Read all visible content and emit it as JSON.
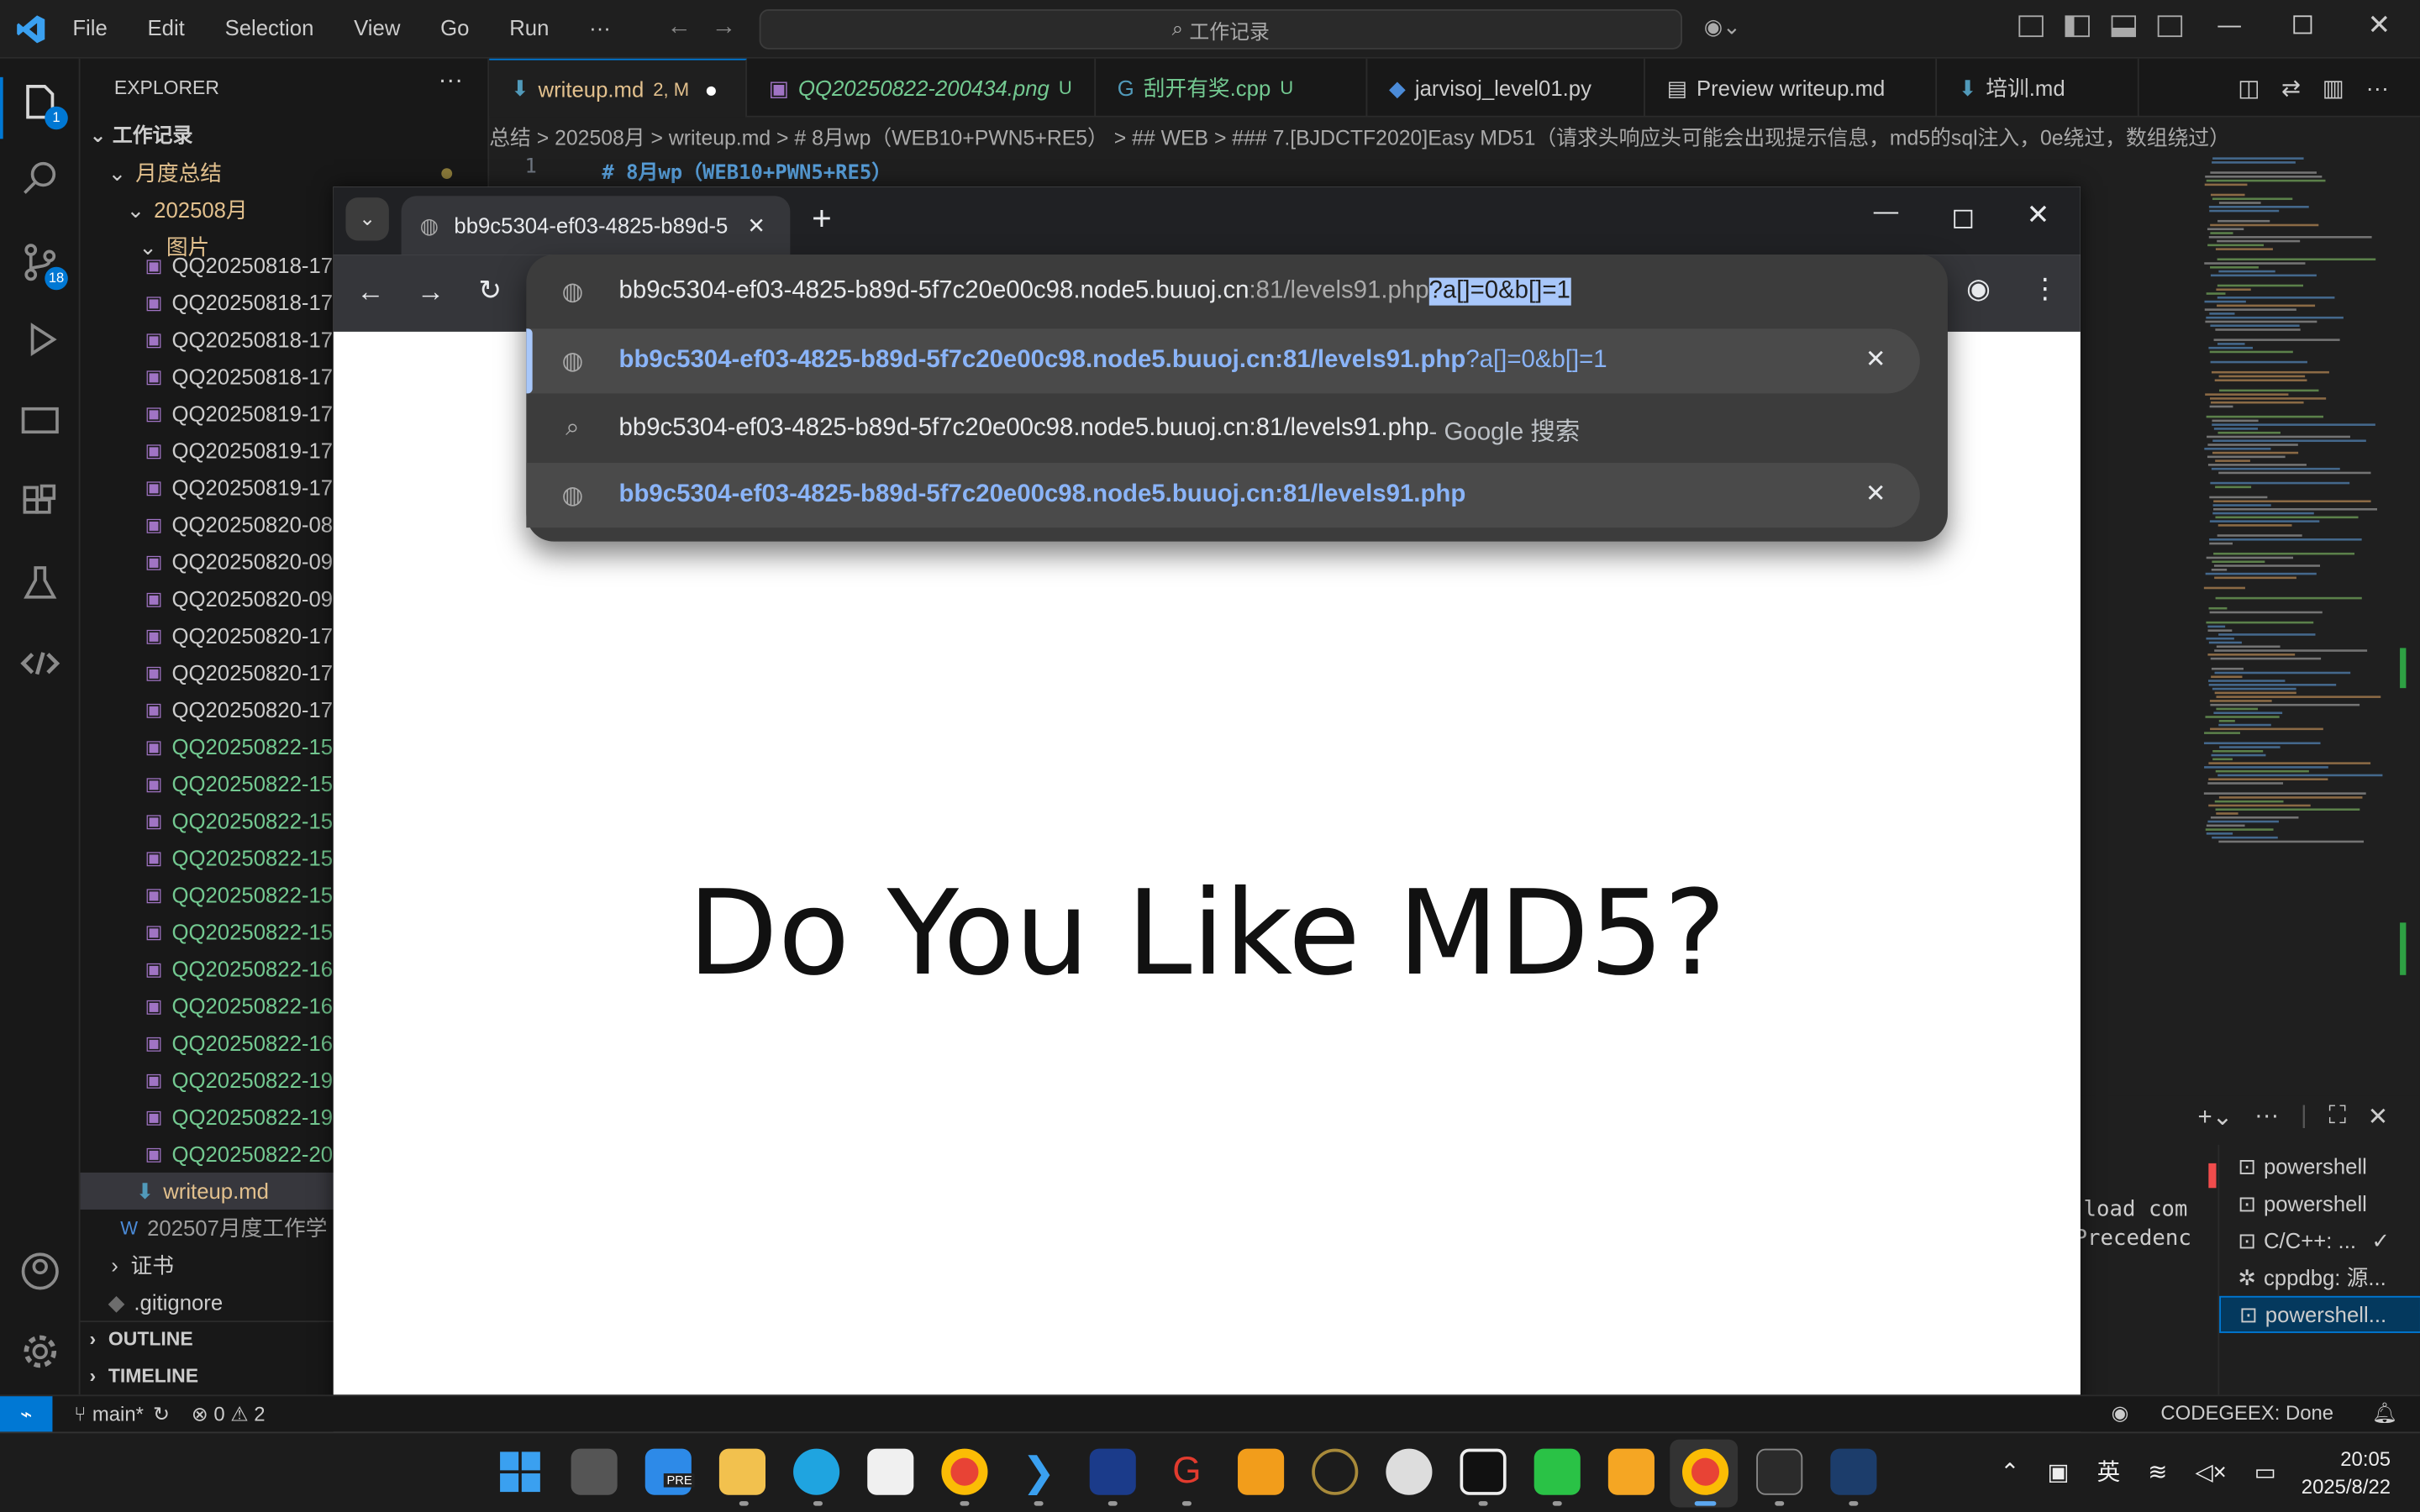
{
  "titlebar": {
    "menus": [
      "File",
      "Edit",
      "Selection",
      "View",
      "Go",
      "Run",
      "···"
    ],
    "search": "工作记录"
  },
  "activity": {
    "explorer_badge": "1",
    "scm_badge": "18"
  },
  "sidebar": {
    "title": "EXPLORER",
    "root": "工作记录",
    "folder1": "月度总结",
    "folder2": "202508月",
    "folder3": "图片",
    "files": [
      "QQ20250818-17",
      "QQ20250818-17",
      "QQ20250818-17",
      "QQ20250818-17",
      "QQ20250819-17",
      "QQ20250819-17",
      "QQ20250819-17",
      "QQ20250820-08",
      "QQ20250820-09",
      "QQ20250820-09",
      "QQ20250820-17",
      "QQ20250820-17",
      "QQ20250820-17",
      "QQ20250822-15",
      "QQ20250822-15",
      "QQ20250822-15",
      "QQ20250822-15",
      "QQ20250822-15",
      "QQ20250822-15",
      "QQ20250822-16",
      "QQ20250822-16",
      "QQ20250822-16",
      "QQ20250822-19",
      "QQ20250822-19",
      "QQ20250822-20"
    ],
    "writeup": "writeup.md",
    "docx": "202507月度工作学",
    "cert": "证书",
    "gitignore": ".gitignore",
    "outline": "OUTLINE",
    "timeline": "TIMELINE"
  },
  "tabs": [
    {
      "label": "writeup.md",
      "suffix": "2, M"
    },
    {
      "label": "QQ20250822-200434.png",
      "suffix": "U"
    },
    {
      "label": "刮开有奖.cpp",
      "suffix": "U"
    },
    {
      "label": "jarvisoj_level01.py",
      "suffix": ""
    },
    {
      "label": "Preview writeup.md",
      "suffix": ""
    },
    {
      "label": "培训.md",
      "suffix": ""
    }
  ],
  "breadcrumb": "总结 > 202508月 > writeup.md > # 8月wp（WEB10+PWN5+RE5） > ## WEB > ### 7.[BJDCTF2020]Easy MD51（请求头响应头可能会出现提示信息，md5的sql注入，0e绕过，数组绕过）",
  "editor": {
    "line_no": "1",
    "line_text": "# 8月wp（WEB10+PWN5+RE5）"
  },
  "chrome": {
    "tab_title": "bb9c5304-ef03-4825-b89d-5",
    "url_base": "bb9c5304-ef03-4825-b89d-5f7c20e00c98.node5.buuoj.cn",
    "url_port_path": ":81/levels91.php",
    "url_query": "?a[]=0&b[]=1",
    "suggestions": [
      {
        "bold": "bb9c5304-ef03-4825-b89d-5f7c20e00c98.node5.buuoj.cn:81/levels91.php",
        "rest": "?a[]=0&b[]=1"
      },
      {
        "text": "bb9c5304-ef03-4825-b89d-5f7c20e00c98.node5.buuoj.cn:81/levels91.php",
        "rest": " - Google 搜索"
      },
      {
        "bold": "bb9c5304-ef03-4825-b89d-5f7c20e00c98.node5.buuoj.cn:81/levels91.php",
        "rest": ""
      }
    ],
    "page_heading": "Do You Like MD5?"
  },
  "terminal": {
    "text1": "load com",
    "text2": "Precedenc",
    "items": [
      "powershell",
      "powershell",
      "C/C++: ...",
      "cppdbg: 源...",
      "powershell..."
    ]
  },
  "statusbar": {
    "branch": "main*",
    "problems": "⊗ 0 ⚠ 2",
    "codegeex": "CODEGEEX: Done"
  },
  "taskbar": {
    "time": "20:05",
    "date": "2025/8/22",
    "lang": "英",
    "pre": "PRE"
  }
}
